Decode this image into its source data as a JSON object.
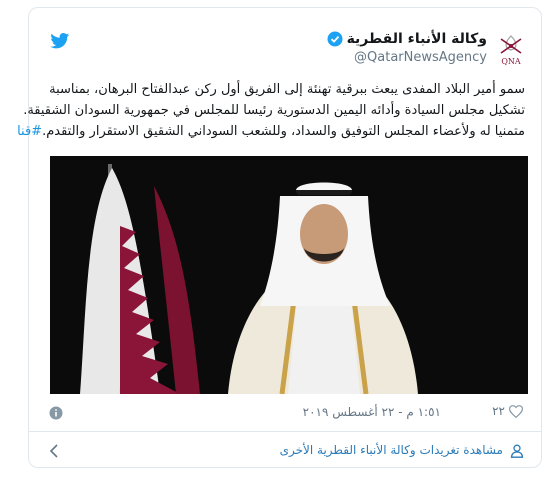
{
  "account": {
    "display_name": "وكالة الأنباء القطرية",
    "handle": "@QatarNewsAgency",
    "logo_text": "QNA",
    "verified": true
  },
  "tweet": {
    "lines": [
      "سمو أمير البلاد المفدى يبعث ببرقية تهنئة إلى الفريق أول ركن عبدالفتاح البرهان، بمناسبة",
      "تشكيل مجلس السيادة وأدائه اليمين الدستورية رئيسا للمجلس في جمهورية السودان الشقيقة.",
      "متمنيا له ولأعضاء المجلس التوفيق والسداد، وللشعب السوداني الشقيق الاستقرار والتقدم."
    ],
    "hashtag": "#قنا"
  },
  "meta": {
    "timestamp": "١:٥١ م - ٢٢ أغسطس ٢٠١٩",
    "likes": "٢٢"
  },
  "more_link": "مشاهدة تغريدات وكالة الأنباء القطرية الأخرى",
  "icons": {
    "twitter": "twitter-bird-icon",
    "verified": "verified-badge-icon",
    "info": "info-icon",
    "heart": "heart-icon",
    "user": "user-icon",
    "chevron": "chevron-left-icon"
  },
  "colors": {
    "twitter_blue": "#1da1f2",
    "link": "#2b7bb9",
    "flag_maroon": "#8a1538"
  }
}
